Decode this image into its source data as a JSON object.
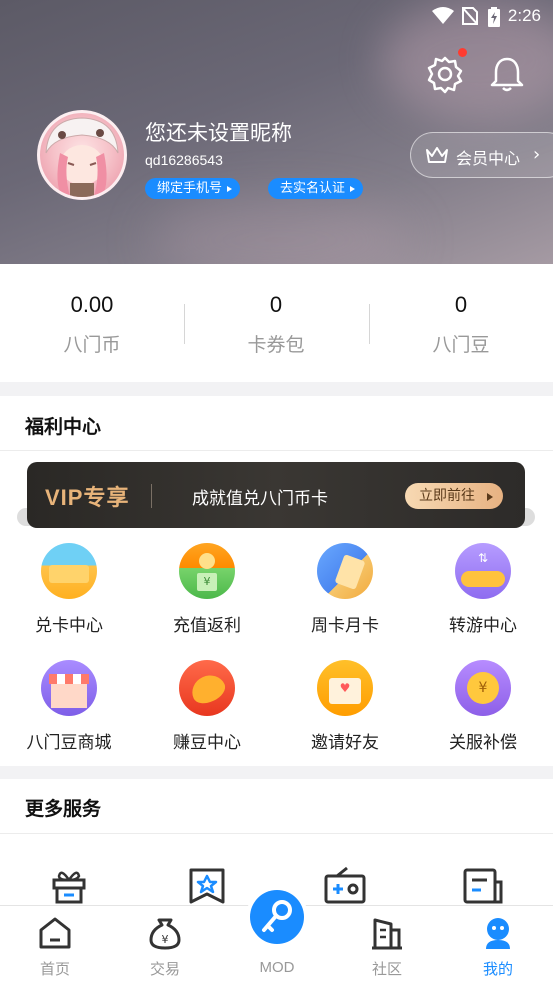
{
  "status_bar": {
    "time": "2:26"
  },
  "profile": {
    "nickname": "您还未设置昵称",
    "user_id": "qd16286543",
    "bind_phone": "绑定手机号",
    "real_name": "去实名认证",
    "vip_center": "会员中心",
    "vip_center_chevron": "›"
  },
  "stats": [
    {
      "value": "0.00",
      "label": "八门币"
    },
    {
      "value": "0",
      "label": "卡券包"
    },
    {
      "value": "0",
      "label": "八门豆"
    }
  ],
  "welfare": {
    "title": "福利中心",
    "banner": {
      "badge": "VIP专享",
      "text": "成就值兑八门币卡",
      "button": "立即前往"
    },
    "items": [
      {
        "label": "兑卡中心",
        "icon": "card-exchange-icon"
      },
      {
        "label": "充值返利",
        "icon": "recharge-rebate-icon"
      },
      {
        "label": "周卡月卡",
        "icon": "weekly-monthly-card-icon"
      },
      {
        "label": "转游中心",
        "icon": "game-transfer-icon"
      },
      {
        "label": "八门豆商城",
        "icon": "bean-shop-icon"
      },
      {
        "label": "赚豆中心",
        "icon": "earn-beans-icon"
      },
      {
        "label": "邀请好友",
        "icon": "invite-friends-icon"
      },
      {
        "label": "关服补偿",
        "icon": "shutdown-compensation-icon"
      }
    ]
  },
  "more_services": {
    "title": "更多服务",
    "icons": [
      "gift-icon",
      "bookmark-star-icon",
      "radio-icon",
      "news-icon"
    ]
  },
  "tabbar": {
    "tabs": [
      {
        "label": "首页",
        "icon": "home-icon"
      },
      {
        "label": "交易",
        "icon": "money-bag-icon"
      },
      {
        "label": "MOD",
        "icon": "key-icon"
      },
      {
        "label": "社区",
        "icon": "building-icon"
      },
      {
        "label": "我的",
        "icon": "profile-icon",
        "active": true
      }
    ]
  },
  "colors": {
    "accent": "#1a8cff",
    "vip_gold": "#e8b47a",
    "badge_red": "#ff3b30"
  }
}
